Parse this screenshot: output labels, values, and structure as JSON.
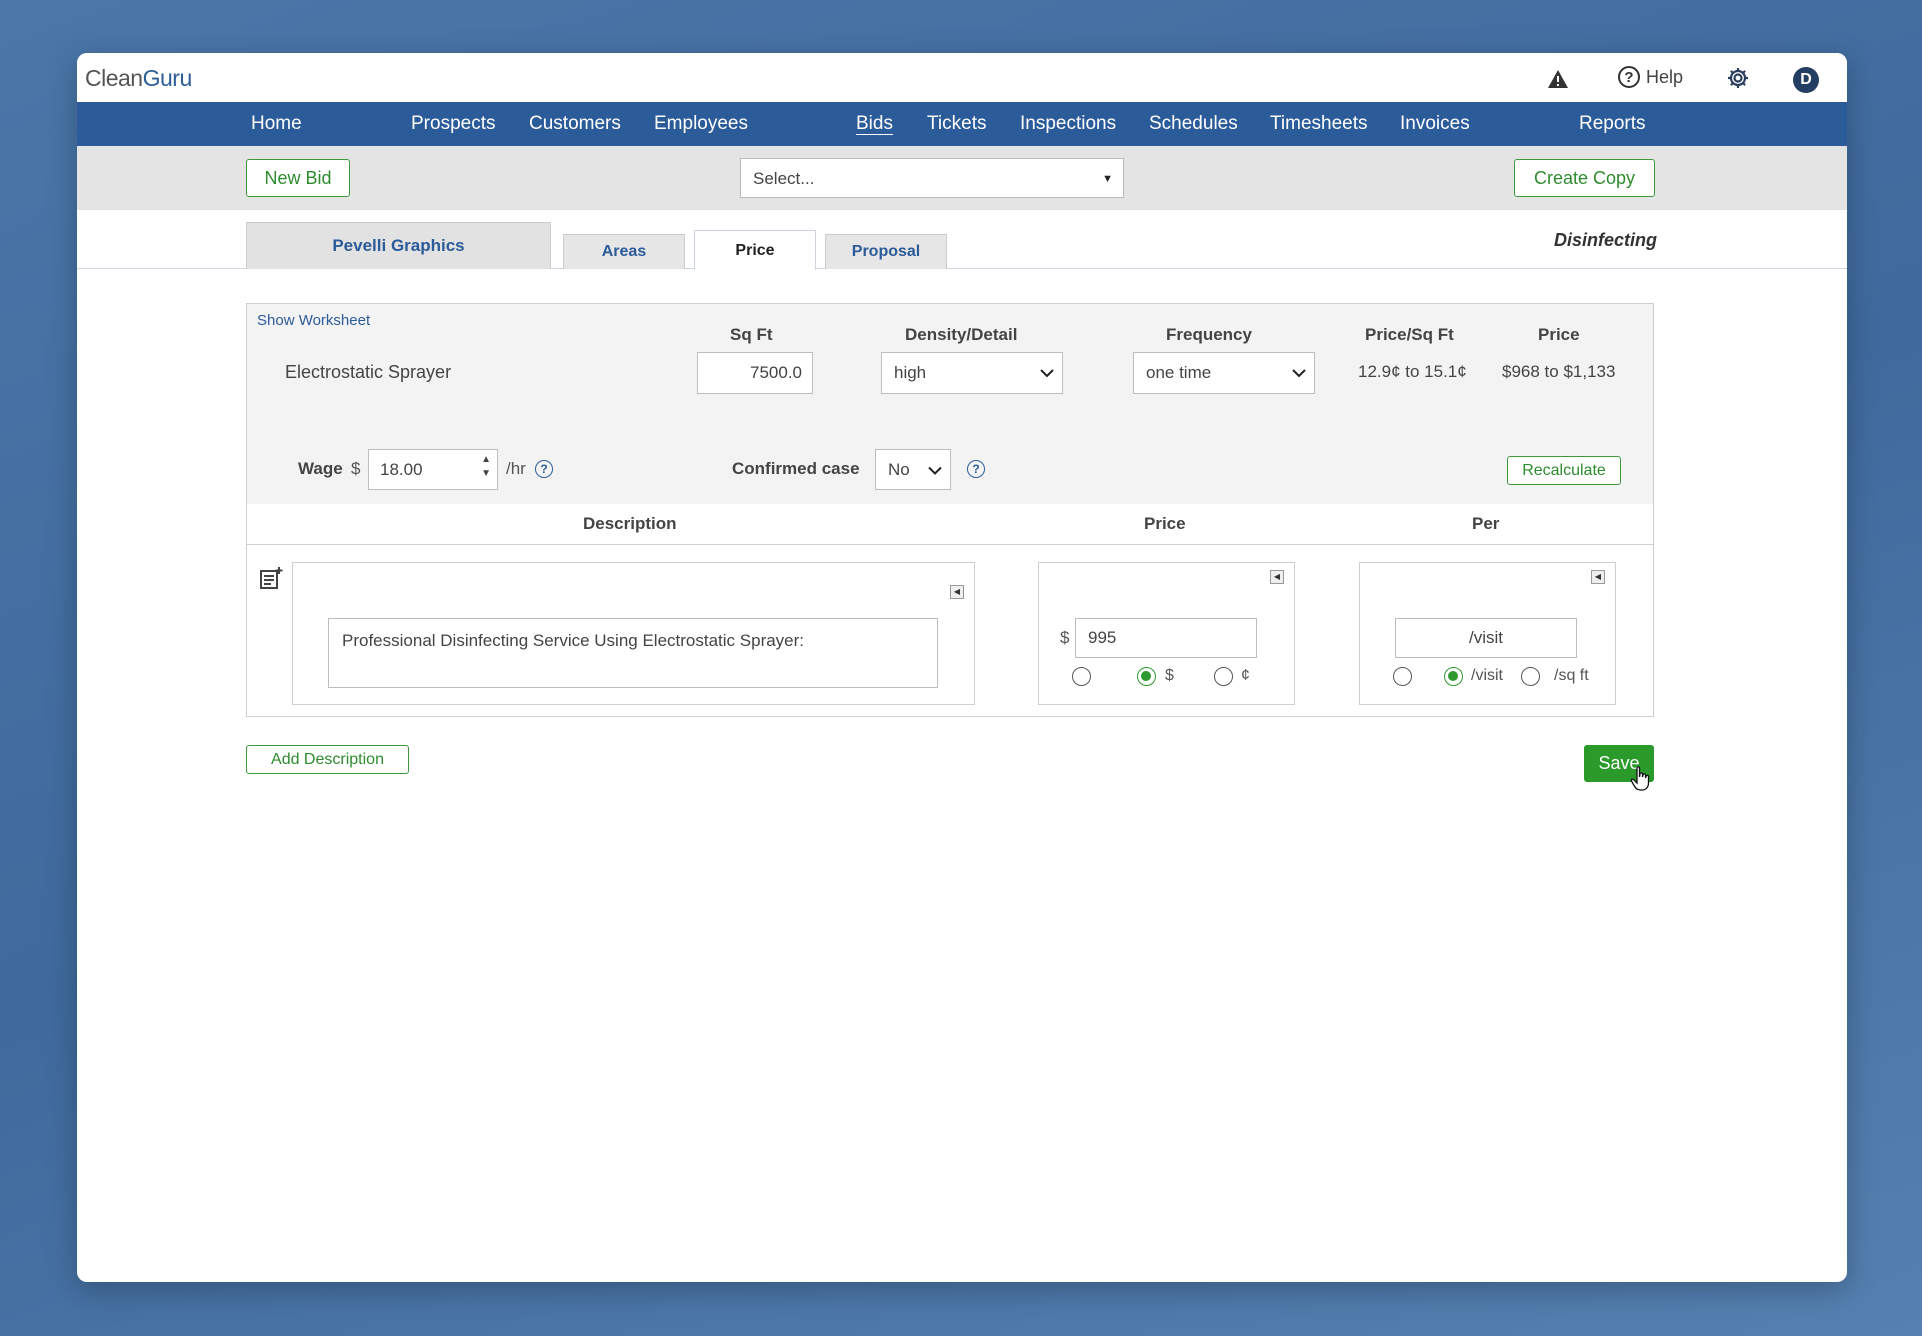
{
  "app": {
    "logo_clean": "Clean",
    "logo_guru": "Guru",
    "help_label": "Help",
    "avatar_letter": "D"
  },
  "nav": {
    "items": [
      {
        "label": "Home"
      },
      {
        "label": "Prospects"
      },
      {
        "label": "Customers"
      },
      {
        "label": "Employees"
      },
      {
        "label": "Bids",
        "active": true
      },
      {
        "label": "Tickets"
      },
      {
        "label": "Inspections"
      },
      {
        "label": "Schedules"
      },
      {
        "label": "Timesheets"
      },
      {
        "label": "Invoices"
      },
      {
        "label": "Reports"
      }
    ]
  },
  "toolbar": {
    "new_bid_label": "New Bid",
    "select_value": "Select...",
    "create_copy_label": "Create Copy"
  },
  "tabs": {
    "customer": "Pevelli Graphics",
    "items": [
      {
        "label": "Areas"
      },
      {
        "label": "Price",
        "active": true
      },
      {
        "label": "Proposal"
      }
    ],
    "service_type": "Disinfecting"
  },
  "worksheet": {
    "show_worksheet": "Show Worksheet",
    "headers": {
      "sqft": "Sq Ft",
      "density": "Density/Detail",
      "frequency": "Frequency",
      "price_per_sqft": "Price/Sq Ft",
      "price": "Price"
    },
    "service_name": "Electrostatic Sprayer",
    "sqft_value": "7500.0",
    "density_value": "high",
    "frequency_value": "one time",
    "price_per_sqft_range": "12.9¢ to 15.1¢",
    "price_range": "$968 to $1,133",
    "wage_label": "Wage",
    "wage_currency": "$",
    "wage_value": "18.00",
    "wage_unit": "/hr",
    "confirmed_case_label": "Confirmed case",
    "confirmed_case_value": "No",
    "recalculate_label": "Recalculate"
  },
  "description_table": {
    "headers": {
      "description": "Description",
      "price": "Price",
      "per": "Per"
    },
    "rows": [
      {
        "description": "Professional Disinfecting Service Using Electrostatic Sprayer:",
        "price_currency": "$",
        "price_value": "995",
        "price_radio_dollar": "$",
        "price_radio_cent": "¢",
        "per_value": "/visit",
        "per_radio_visit": "/visit",
        "per_radio_sqft": "/sq ft"
      }
    ]
  },
  "actions": {
    "add_description_label": "Add Description",
    "save_label": "Save"
  },
  "colors": {
    "nav_bg": "#2b5b99",
    "accent_green": "#2a9a2a",
    "background": "#4a76a8"
  }
}
